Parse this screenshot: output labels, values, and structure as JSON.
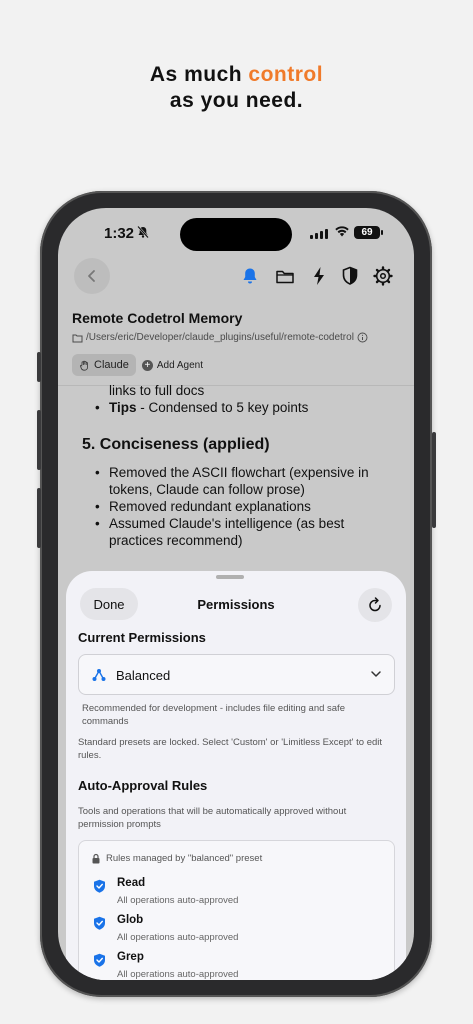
{
  "headline": {
    "prefix": "As much",
    "accent": "control",
    "line2": "as you need.",
    "accent_color": "#f07a2a"
  },
  "status_bar": {
    "time": "1:32",
    "bell_off_icon": "bell-slash",
    "battery": "69"
  },
  "toolbar": {
    "back_icon": "chevron-left",
    "icons": [
      "bell-icon",
      "folder-icon",
      "bolt-icon",
      "shield-icon",
      "gear-icon"
    ],
    "active_color": "#1a73e8"
  },
  "project": {
    "title": "Remote Codetrol Memory",
    "path": "/Users/eric/Developer/claude_plugins/useful/remote-codetrol",
    "agent_chip": "Claude",
    "add_agent": "Add Agent"
  },
  "document": {
    "cut_line": "links to full docs",
    "tips_bold": "Tips",
    "tips_rest": " - Condensed to 5 key points",
    "section_heading": "5. Conciseness (applied)",
    "bullets": [
      "Removed the ASCII flowchart (expensive in tokens, Claude can follow prose)",
      "Removed redundant explanations",
      "Assumed Claude's intelligence (as best practices recommend)"
    ]
  },
  "sheet": {
    "done_label": "Done",
    "title": "Permissions",
    "current_permissions_heading": "Current Permissions",
    "selected_preset": "Balanced",
    "preset_description": "Recommended for development - includes file editing and safe commands",
    "locked_note": "Standard presets are locked. Select 'Custom' or 'Limitless Except' to edit rules.",
    "auto_approval_heading": "Auto-Approval Rules",
    "auto_approval_description": "Tools and operations that will be automatically approved without permission prompts",
    "managed_label": "Rules managed by \"balanced\" preset",
    "rules": [
      {
        "name": "Read",
        "desc": "All operations auto-approved"
      },
      {
        "name": "Glob",
        "desc": "All operations auto-approved"
      },
      {
        "name": "Grep",
        "desc": "All operations auto-approved"
      }
    ],
    "check_color": "#1a73e8"
  }
}
